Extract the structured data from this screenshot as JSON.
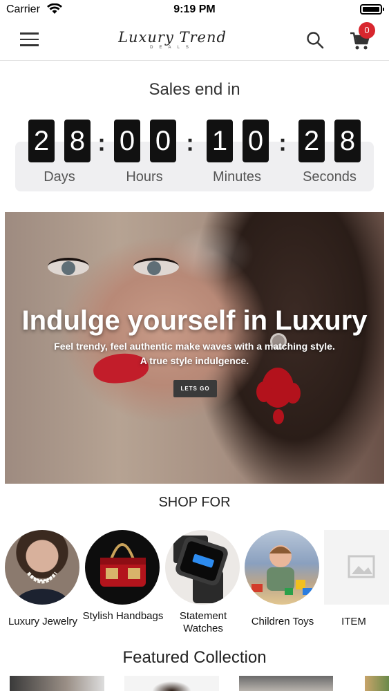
{
  "status_bar": {
    "carrier": "Carrier",
    "time": "9:19 PM"
  },
  "nav": {
    "logo_script": "Luxury Trend",
    "logo_sub": "DEALS",
    "cart_count": "0",
    "icons": [
      "menu-icon",
      "logo",
      "search-icon",
      "cart-icon"
    ]
  },
  "countdown": {
    "title": "Sales end in",
    "days": [
      "2",
      "8"
    ],
    "hours": [
      "0",
      "0"
    ],
    "minutes": [
      "1",
      "0"
    ],
    "seconds": [
      "2",
      "8"
    ],
    "separator": ":",
    "labels": {
      "days": "Days",
      "hours": "Hours",
      "minutes": "Minutes",
      "seconds": "Seconds"
    }
  },
  "hero": {
    "headline": "Indulge yourself in Luxury",
    "tagline_1": "Feel trendy, feel authentic make waves with a matching style.",
    "tagline_2": "A true style indulgence.",
    "cta": "LETS GO"
  },
  "shop_for": {
    "title": "SHOP FOR",
    "categories": [
      {
        "label": "Luxury Jewelry"
      },
      {
        "label": "Stylish Handbags"
      },
      {
        "label": "Statement Watches"
      },
      {
        "label": "Children Toys"
      },
      {
        "label": "ITEM"
      }
    ]
  },
  "featured": {
    "title": "Featured Collection"
  },
  "colors": {
    "badge": "#d8262e",
    "digit_bg": "#111111",
    "panel_bg": "#efeff1",
    "cta_bg": "#3a3a3a"
  }
}
